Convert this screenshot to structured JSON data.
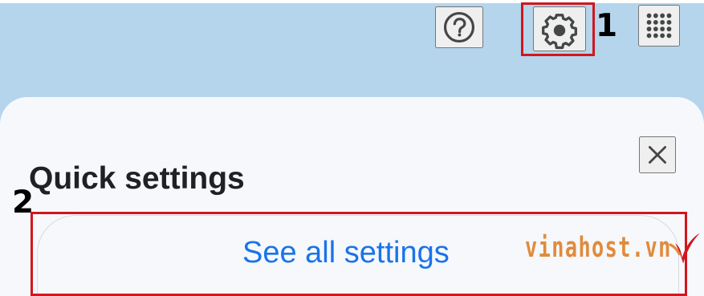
{
  "toolbar": {
    "help_icon": "help-circle-icon",
    "settings_icon": "gear-icon",
    "apps_icon": "apps-grid-icon"
  },
  "annotations": {
    "step_1": "1",
    "step_2": "2",
    "highlight_color": "#d1161d"
  },
  "quick_settings": {
    "title": "Quick settings",
    "close_icon": "close-icon",
    "see_all_label": "See all settings"
  },
  "watermark": {
    "text": "vinahost.vn",
    "accent_color": "#e08b3c",
    "mark_color": "#d1161d"
  },
  "colors": {
    "header_background": "#b4d5ec",
    "panel_background": "#f6f8fc",
    "link_blue": "#1a73e8",
    "icon_gray": "#444746",
    "text_dark": "#202124"
  }
}
